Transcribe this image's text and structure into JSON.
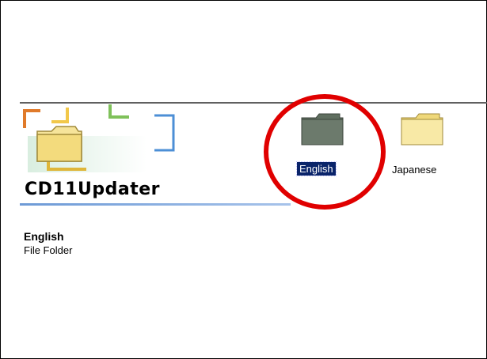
{
  "window": {
    "folder_name": "CD11Updater"
  },
  "details": {
    "selected_name": "English",
    "selected_type": "File Folder"
  },
  "items": [
    {
      "label": "English",
      "selected": true,
      "icon": "folder-dimmed-icon"
    },
    {
      "label": "Japanese",
      "selected": false,
      "icon": "folder-icon"
    }
  ],
  "colors": {
    "selection_bg": "#0a246a",
    "annotation_circle": "#e00000",
    "folder_yellow": "#f4e08e",
    "folder_dimmed": "#6c7a6c"
  }
}
